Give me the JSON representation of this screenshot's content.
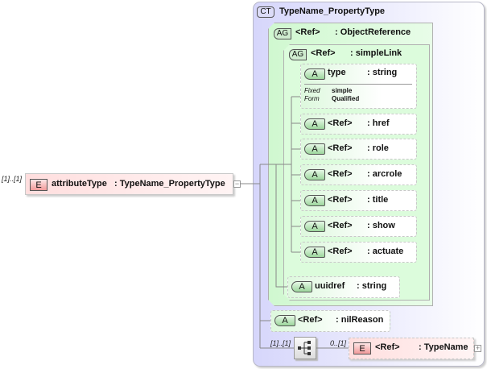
{
  "root": {
    "occurrence": "[1]..[1]",
    "badge": "E",
    "name": "attributeType",
    "type": ": TypeName_PropertyType",
    "toggle": "−"
  },
  "complex_type": {
    "badge": "CT",
    "name": "TypeName_PropertyType"
  },
  "object_reference": {
    "badge": "AG",
    "ref": "<Ref>",
    "type": ": ObjectReference"
  },
  "simple_link": {
    "badge": "AG",
    "ref": "<Ref>",
    "type": ": simpleLink"
  },
  "type_attr": {
    "badge": "A",
    "name": "type",
    "type": ": string",
    "fixed_label": "Fixed",
    "fixed_value": "simple",
    "form_label": "Form",
    "form_value": "Qualified"
  },
  "attributes": [
    {
      "badge": "A",
      "name": "<Ref>",
      "type": ": href"
    },
    {
      "badge": "A",
      "name": "<Ref>",
      "type": ": role"
    },
    {
      "badge": "A",
      "name": "<Ref>",
      "type": ": arcrole"
    },
    {
      "badge": "A",
      "name": "<Ref>",
      "type": ": title"
    },
    {
      "badge": "A",
      "name": "<Ref>",
      "type": ": show"
    },
    {
      "badge": "A",
      "name": "<Ref>",
      "type": ": actuate"
    }
  ],
  "uuidref": {
    "badge": "A",
    "name": "uuidref",
    "type": ": string"
  },
  "nil_reason": {
    "badge": "A",
    "name": "<Ref>",
    "type": ": nilReason"
  },
  "sequence": {
    "occurrence": "[1]..[1]",
    "icon": "sequence-icon"
  },
  "type_name": {
    "occurrence": "0..[1]",
    "badge": "E",
    "name": "<Ref>",
    "type": ": TypeName",
    "toggle": "+"
  }
}
